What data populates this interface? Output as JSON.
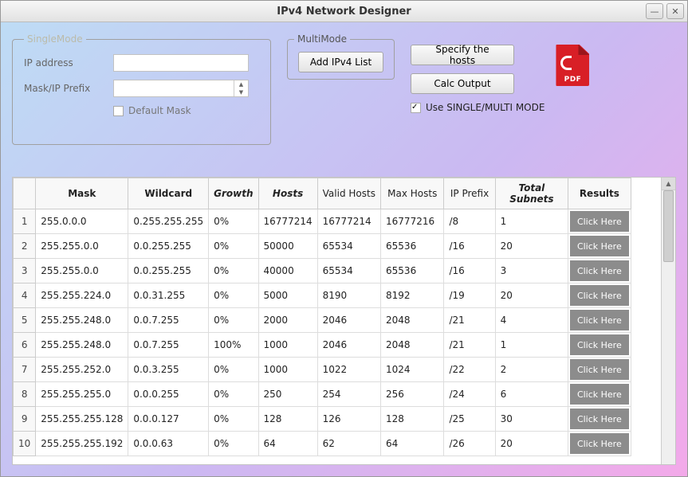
{
  "window": {
    "title": "IPv4 Network Designer"
  },
  "singleMode": {
    "legend": "SingleMode",
    "ipLabel": "IP address",
    "maskLabel": "Mask/IP Prefix",
    "defaultMaskLabel": "Default Mask"
  },
  "multiMode": {
    "legend": "MultiMode",
    "addButton": "Add IPv4 List"
  },
  "actions": {
    "specify": "Specify the hosts",
    "calc": "Calc Output",
    "pdfLabel": "PDF",
    "useModeLabel": "Use SINGLE/MULTI  MODE"
  },
  "table": {
    "headers": {
      "mask": "Mask",
      "wildcard": "Wildcard",
      "growth": "Growth",
      "hosts": "Hosts",
      "validHosts": "Valid Hosts",
      "maxHosts": "Max Hosts",
      "ipPrefix": "IP Prefix",
      "totalSubnets": "Total Subnets",
      "results": "Results"
    },
    "buttonLabel": "Click Here",
    "rows": [
      {
        "n": "1",
        "mask": "255.0.0.0",
        "wildcard": "0.255.255.255",
        "growth": "0%",
        "hosts": "16777214",
        "valid": "16777214",
        "max": "16777216",
        "prefix": "/8",
        "subnets": "1"
      },
      {
        "n": "2",
        "mask": "255.255.0.0",
        "wildcard": "0.0.255.255",
        "growth": "0%",
        "hosts": "50000",
        "valid": "65534",
        "max": "65536",
        "prefix": "/16",
        "subnets": "20"
      },
      {
        "n": "3",
        "mask": "255.255.0.0",
        "wildcard": "0.0.255.255",
        "growth": "0%",
        "hosts": "40000",
        "valid": "65534",
        "max": "65536",
        "prefix": "/16",
        "subnets": "3"
      },
      {
        "n": "4",
        "mask": "255.255.224.0",
        "wildcard": "0.0.31.255",
        "growth": "0%",
        "hosts": "5000",
        "valid": "8190",
        "max": "8192",
        "prefix": "/19",
        "subnets": "20"
      },
      {
        "n": "5",
        "mask": "255.255.248.0",
        "wildcard": "0.0.7.255",
        "growth": "0%",
        "hosts": "2000",
        "valid": "2046",
        "max": "2048",
        "prefix": "/21",
        "subnets": "4"
      },
      {
        "n": "6",
        "mask": "255.255.248.0",
        "wildcard": "0.0.7.255",
        "growth": "100%",
        "hosts": "1000",
        "valid": "2046",
        "max": "2048",
        "prefix": "/21",
        "subnets": "1"
      },
      {
        "n": "7",
        "mask": "255.255.252.0",
        "wildcard": "0.0.3.255",
        "growth": "0%",
        "hosts": "1000",
        "valid": "1022",
        "max": "1024",
        "prefix": "/22",
        "subnets": "2"
      },
      {
        "n": "8",
        "mask": "255.255.255.0",
        "wildcard": "0.0.0.255",
        "growth": "0%",
        "hosts": "250",
        "valid": "254",
        "max": "256",
        "prefix": "/24",
        "subnets": "6"
      },
      {
        "n": "9",
        "mask": "255.255.255.128",
        "wildcard": "0.0.0.127",
        "growth": "0%",
        "hosts": "128",
        "valid": "126",
        "max": "128",
        "prefix": "/25",
        "subnets": "30"
      },
      {
        "n": "10",
        "mask": "255.255.255.192",
        "wildcard": "0.0.0.63",
        "growth": "0%",
        "hosts": "64",
        "valid": "62",
        "max": "64",
        "prefix": "/26",
        "subnets": "20"
      }
    ]
  }
}
